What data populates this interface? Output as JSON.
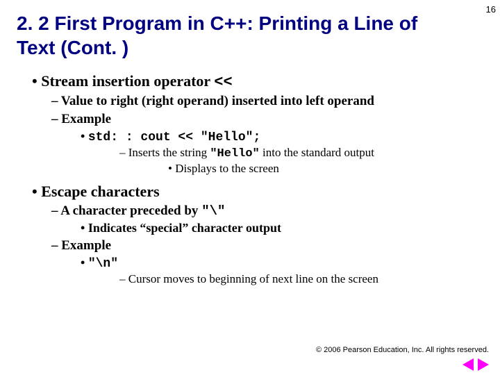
{
  "pageNumber": "16",
  "title": "2. 2 First Program in C++: Printing a Line of Text (Cont. )",
  "b1": {
    "text_a": "Stream insertion operator ",
    "op": "<<",
    "d1": "Value to right (right operand) inserted into left operand",
    "d2": "Example",
    "code": "std: : cout << \"Hello\";",
    "ins_a": "Inserts the string ",
    "ins_code": "\"Hello\"",
    "ins_b": " into the standard output",
    "disp": "Displays to the screen"
  },
  "b2": {
    "text": "Escape characters",
    "d1_a": "A character preceded by ",
    "d1_code": "\"\\\"",
    "ind": "Indicates “special” character output",
    "d2": "Example",
    "ex_code": "\"\\n\"",
    "cur": "Cursor moves to beginning of next line on the screen"
  },
  "copyright": "© 2006 Pearson Education, Inc. All rights reserved."
}
